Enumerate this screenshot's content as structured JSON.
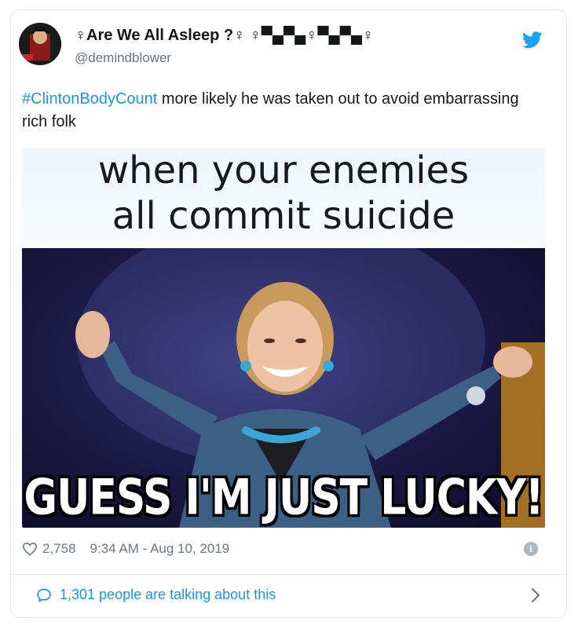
{
  "author": {
    "display_name": "♀Are We All Asleep ?♀ ♀▀▄▀▄♀▀▄▀▄♀",
    "handle": "@demindblower"
  },
  "tweet": {
    "hashtag": "#ClintonBodyCount",
    "text": " more likely he was taken out to avoid embarrassing rich folk"
  },
  "media": {
    "caption_top_line1": "when your enemies",
    "caption_top_line2": "all commit suicide",
    "caption_bottom": "GUESS I'M JUST LUCKY!"
  },
  "meta": {
    "likes": "2,758",
    "timestamp": "9:34 AM - Aug 10, 2019",
    "info_glyph": "i"
  },
  "footer": {
    "talking_label": "1,301 people are talking about this"
  },
  "colors": {
    "link_blue": "#1b95e0",
    "muted_gray": "#657786",
    "twitter_blue": "#1da1f2"
  },
  "icons": [
    "twitter-bird-icon",
    "heart-icon",
    "info-icon",
    "speech-bubble-icon",
    "chevron-right-icon"
  ]
}
